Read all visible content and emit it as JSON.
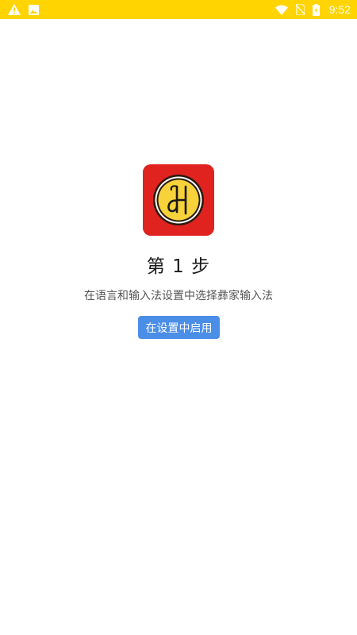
{
  "status_bar": {
    "time": "9:52",
    "background": "#ffd400",
    "icons_left": [
      "warning-icon",
      "image-icon"
    ],
    "icons_right": [
      "wifi-icon",
      "no-sim-icon",
      "battery-icon"
    ]
  },
  "main": {
    "app_icon": "yi-input-logo-icon",
    "step_title": "第 1 步",
    "step_description": "在语言和输入法设置中选择彝家输入法",
    "enable_button_label": "在设置中启用",
    "accent_color": "#4a8ee8",
    "icon_background": "#e0231f"
  }
}
